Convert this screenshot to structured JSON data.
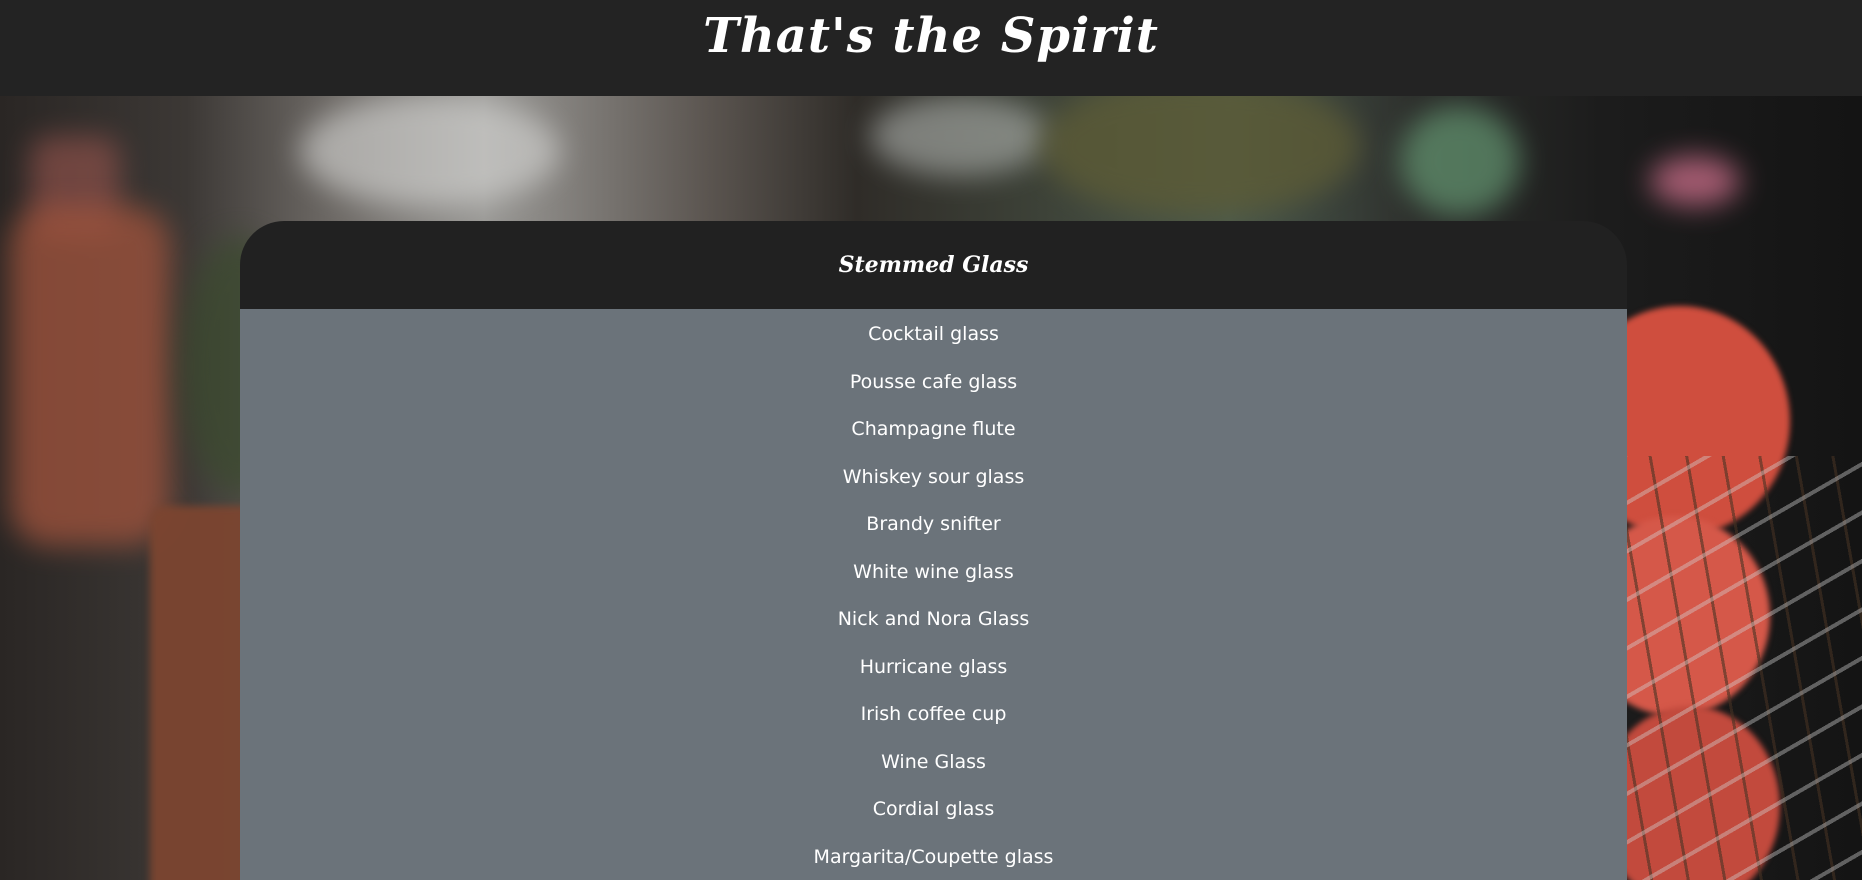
{
  "header": {
    "title": "That's the Spirit"
  },
  "card": {
    "title": "Stemmed Glass",
    "items": [
      "Cocktail glass",
      "Pousse cafe glass",
      "Champagne flute",
      "Whiskey sour glass",
      "Brandy snifter",
      "White wine glass",
      "Nick and Nora Glass",
      "Hurricane glass",
      "Irish coffee cup",
      "Wine Glass",
      "Cordial glass",
      "Margarita/Coupette glass"
    ]
  },
  "colors": {
    "header_bg": "#232323",
    "card_header_bg": "#212121",
    "card_body_bg": "#6b737a",
    "text": "#ffffff"
  }
}
